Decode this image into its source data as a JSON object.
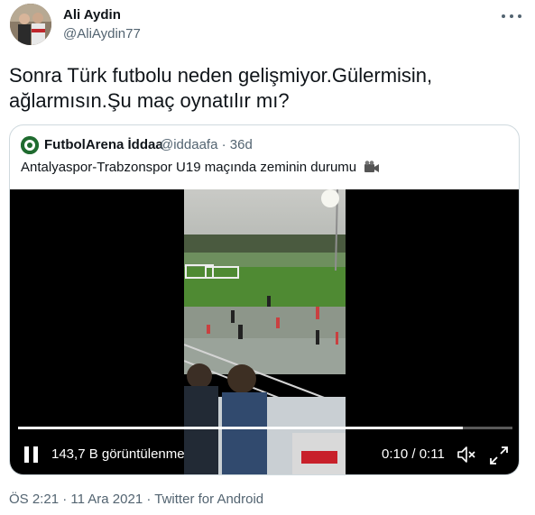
{
  "author": {
    "name": "Ali Aydin",
    "handle": "@AliAydin77"
  },
  "tweet": {
    "text": "Sonra Türk futbolu neden gelişmiyor.Gülermisin, ağlarmısın.Şu maç oynatılır mı?"
  },
  "quoted": {
    "name": "FutbolArena İddaa",
    "handle": "@iddaafa",
    "separator": "·",
    "age": "36d",
    "text": "Antalyaspor-Trabzonspor U19 maçında zeminin durumu",
    "emoji_icon": "movie-camera-icon"
  },
  "video": {
    "views": "143,7 B görüntülenme",
    "current_time": "0:10",
    "time_separator": "/",
    "duration": "0:11",
    "progress": 0.9
  },
  "footer": {
    "time": "ÖS 2:21",
    "dot1": "·",
    "date": "11 Ara 2021",
    "dot2": "·",
    "client": "Twitter for Android"
  },
  "colors": {
    "text": "#0f1419",
    "secondary": "#536471",
    "border": "#cfd9de",
    "pitch": "#4f8a33"
  }
}
